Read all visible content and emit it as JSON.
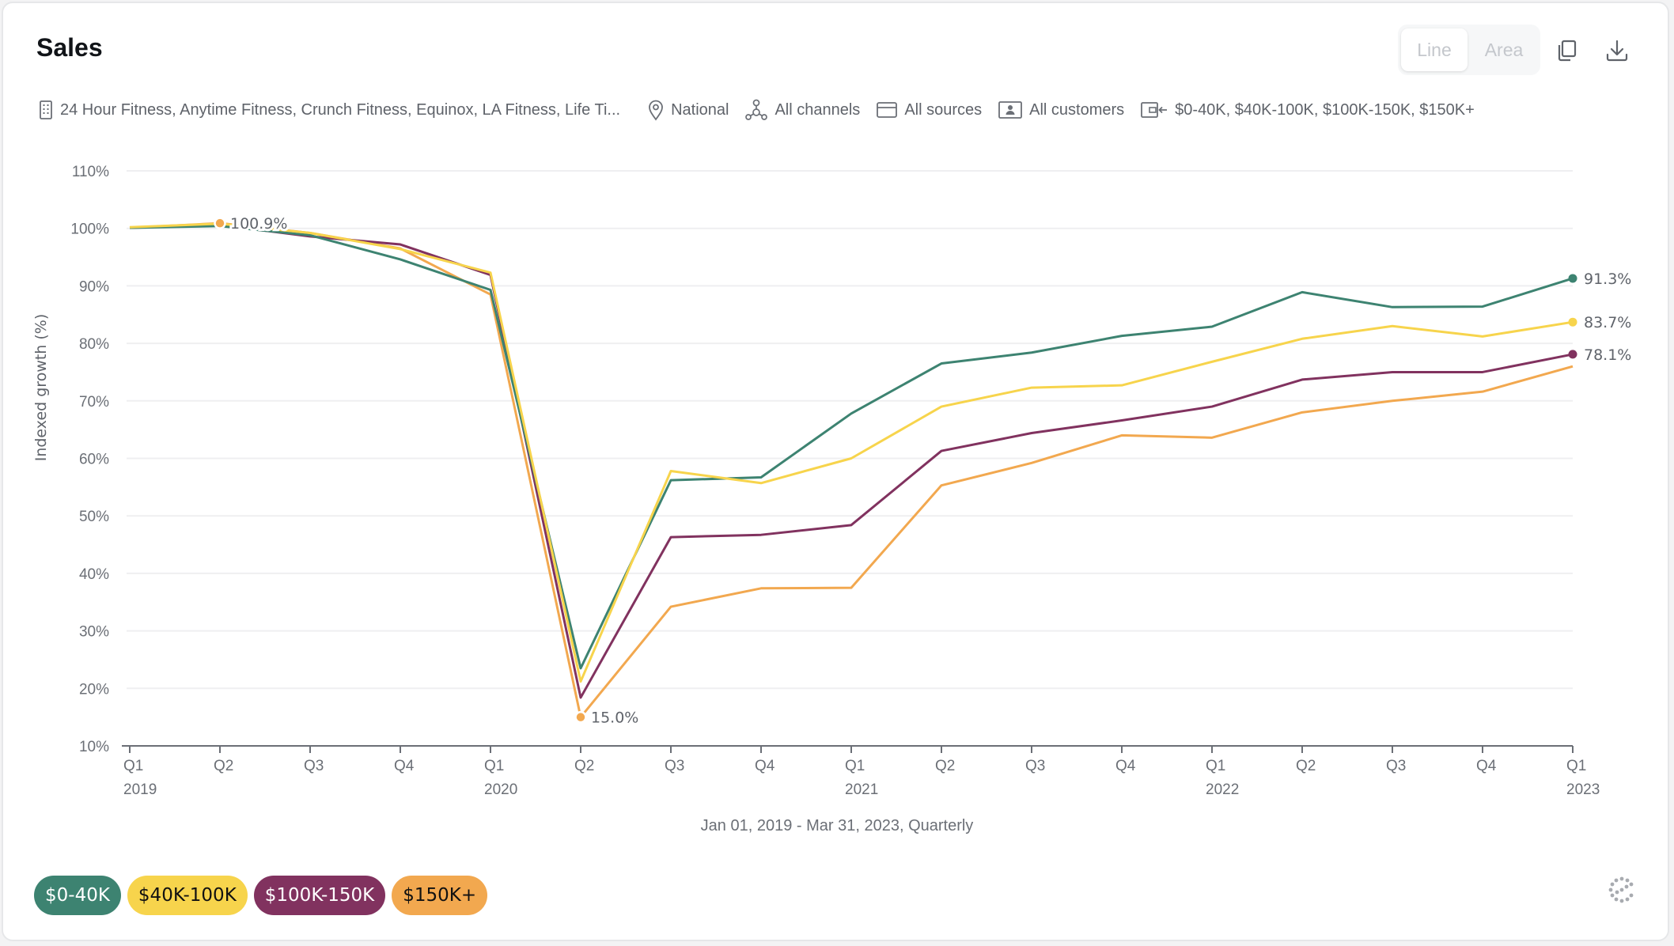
{
  "header": {
    "title": "Sales",
    "view_toggle": {
      "options": [
        "Line",
        "Area"
      ],
      "selected": "Line"
    },
    "actions": [
      {
        "name": "copy",
        "icon": "copy-icon"
      },
      {
        "name": "download",
        "icon": "download-icon"
      }
    ]
  },
  "filters": [
    {
      "icon": "building-icon",
      "label": "24 Hour Fitness, Anytime Fitness, Crunch Fitness, Equinox, LA Fitness, Life Ti..."
    },
    {
      "icon": "location-pin-icon",
      "label": "National"
    },
    {
      "icon": "channels-icon",
      "label": "All channels"
    },
    {
      "icon": "card-icon",
      "label": "All sources"
    },
    {
      "icon": "customer-icon",
      "label": "All customers"
    },
    {
      "icon": "wallet-income-icon",
      "label": "$0-40K, $40K-100K, $100K-150K, $150K+"
    }
  ],
  "footer": {
    "date_range": "Jan 01, 2019 - Mar 31, 2023, Quarterly",
    "loading_icon": "dots-spinner-icon"
  },
  "chart_data": {
    "type": "line",
    "title": "Sales",
    "xlabel": "",
    "ylabel": "Indexed growth (%)",
    "ylim": [
      10,
      110
    ],
    "yticks": [
      10,
      20,
      30,
      40,
      50,
      60,
      70,
      80,
      90,
      100,
      110
    ],
    "ytick_labels": [
      "10%",
      "20%",
      "30%",
      "40%",
      "50%",
      "60%",
      "70%",
      "80%",
      "90%",
      "100%",
      "110%"
    ],
    "grid": true,
    "legend_position": "bottom-left",
    "categories": [
      "Q1 2019",
      "Q2 2019",
      "Q3 2019",
      "Q4 2019",
      "Q1 2020",
      "Q2 2020",
      "Q3 2020",
      "Q4 2020",
      "Q1 2021",
      "Q2 2021",
      "Q3 2021",
      "Q4 2021",
      "Q1 2022",
      "Q2 2022",
      "Q3 2022",
      "Q4 2022",
      "Q1 2023"
    ],
    "x_tick_quarters": [
      "Q1",
      "Q2",
      "Q3",
      "Q4",
      "Q1",
      "Q2",
      "Q3",
      "Q4",
      "Q1",
      "Q2",
      "Q3",
      "Q4",
      "Q1",
      "Q2",
      "Q3",
      "Q4",
      "Q1"
    ],
    "x_tick_years": [
      "2019",
      "",
      "",
      "",
      "2020",
      "",
      "",
      "",
      "2021",
      "",
      "",
      "",
      "2022",
      "",
      "",
      "",
      "2023"
    ],
    "series": [
      {
        "name": "$0-40K",
        "color": "#3d8371",
        "text_color": "#ffffff",
        "values": [
          100.1,
          100.4,
          98.8,
          94.6,
          89.3,
          23.5,
          56.2,
          56.7,
          67.8,
          76.5,
          78.4,
          81.3,
          82.9,
          88.9,
          86.3,
          86.4,
          91.3
        ],
        "end_label": "91.3%"
      },
      {
        "name": "$40K-100K",
        "color": "#f7d44c",
        "text_color": "#111111",
        "values": [
          100.2,
          100.8,
          99.2,
          96.4,
          92.3,
          21.2,
          57.8,
          55.7,
          60.0,
          69.0,
          72.3,
          72.7,
          76.8,
          80.8,
          83.0,
          81.2,
          83.7
        ],
        "end_label": "83.7%"
      },
      {
        "name": "$100K-150K",
        "color": "#81325f",
        "text_color": "#ffffff",
        "values": [
          100.1,
          100.6,
          98.6,
          97.2,
          91.9,
          18.4,
          46.3,
          46.7,
          48.4,
          61.3,
          64.4,
          66.6,
          69.0,
          73.7,
          75.0,
          75.0,
          78.1
        ],
        "end_label": "78.1%"
      },
      {
        "name": "$150K+",
        "color": "#f2a84f",
        "text_color": "#111111",
        "values": [
          100.1,
          100.9,
          99.2,
          96.5,
          88.5,
          15.0,
          34.2,
          37.4,
          37.5,
          55.3,
          59.2,
          64.0,
          63.6,
          68.0,
          70.0,
          71.6,
          76.0
        ],
        "end_label": null
      }
    ],
    "annotations": [
      {
        "series": "$150K+",
        "category": "Q2 2019",
        "label": "100.9%"
      },
      {
        "series": "$150K+",
        "category": "Q2 2020",
        "label": "15.0%"
      }
    ]
  }
}
